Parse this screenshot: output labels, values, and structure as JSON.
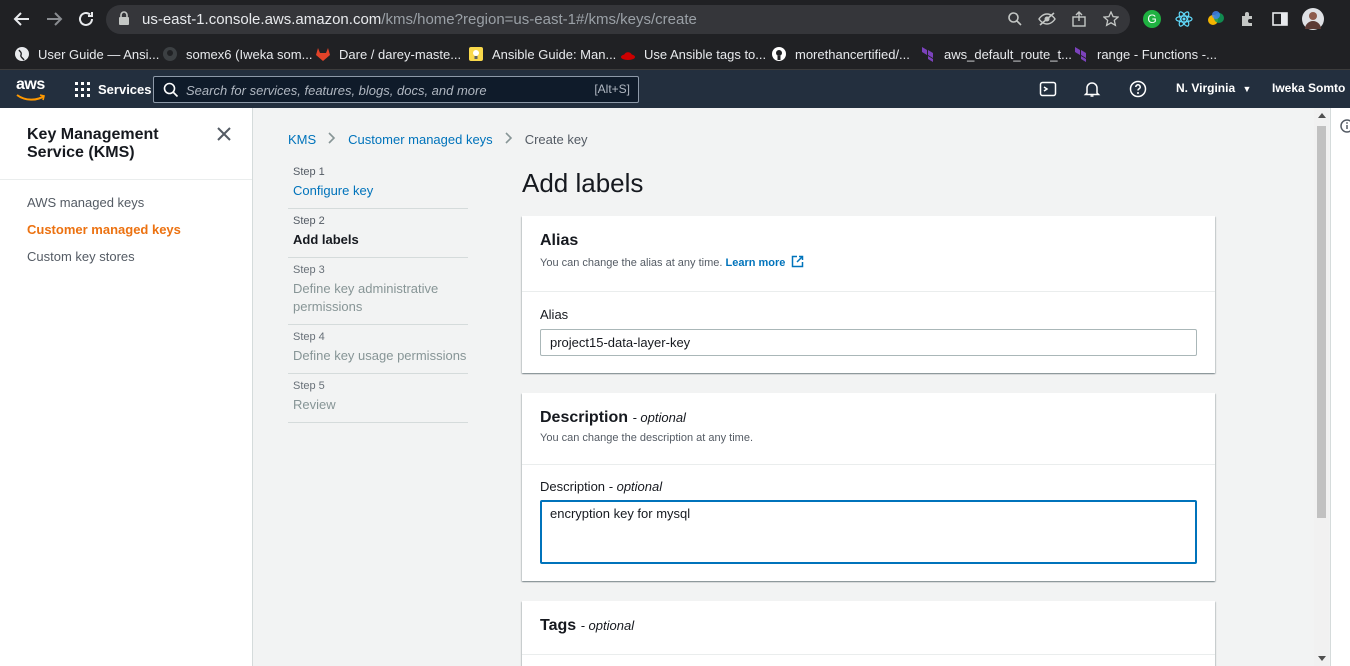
{
  "browser": {
    "url_host": "us-east-1.console.aws.amazon.com",
    "url_path": "/kms/home?region=us-east-1#/kms/keys/create",
    "bookmarks": [
      {
        "label": "User Guide — Ansi...",
        "icon": "globe-icon",
        "color": "#e8eaed"
      },
      {
        "label": "somex6 (Iweka som...",
        "icon": "github-icon",
        "color": "#5f6368"
      },
      {
        "label": "Dare / darey-maste...",
        "icon": "gitlab-icon",
        "color": "#e24329"
      },
      {
        "label": "Ansible Guide: Man...",
        "icon": "bulb-icon",
        "color": "#f9d94b"
      },
      {
        "label": "Use Ansible tags to...",
        "icon": "redhat-icon",
        "color": "#cc0000"
      },
      {
        "label": "morethancertified/...",
        "icon": "github-icon",
        "color": "#ffffff"
      },
      {
        "label": "aws_default_route_t...",
        "icon": "terraform-icon",
        "color": "#7b42bc"
      },
      {
        "label": "range - Functions -...",
        "icon": "terraform-icon",
        "color": "#7b42bc"
      }
    ]
  },
  "aws_header": {
    "logo": "aws",
    "services_label": "Services",
    "search_placeholder": "Search for services, features, blogs, docs, and more",
    "search_shortcut": "[Alt+S]",
    "region": "N. Virginia",
    "user": "Iweka Somto",
    "accent_color": "#ff9900"
  },
  "sidenav": {
    "title": "Key Management Service (KMS)",
    "items": [
      {
        "label": "AWS managed keys",
        "active": false
      },
      {
        "label": "Customer managed keys",
        "active": true
      },
      {
        "label": "Custom key stores",
        "active": false
      }
    ]
  },
  "breadcrumb": {
    "items": [
      {
        "label": "KMS",
        "link": true
      },
      {
        "label": "Customer managed keys",
        "link": true
      },
      {
        "label": "Create key",
        "link": false
      }
    ]
  },
  "steps": [
    {
      "num": "Step 1",
      "title": "Configure key",
      "state": "link"
    },
    {
      "num": "Step 2",
      "title": "Add labels",
      "state": "current"
    },
    {
      "num": "Step 3",
      "title": "Define key administrative permissions",
      "state": "disabled"
    },
    {
      "num": "Step 4",
      "title": "Define key usage permissions",
      "state": "disabled"
    },
    {
      "num": "Step 5",
      "title": "Review",
      "state": "disabled"
    }
  ],
  "main": {
    "heading": "Add labels",
    "alias_panel": {
      "title": "Alias",
      "desc": "You can change the alias at any time.",
      "learn_more": "Learn more",
      "field_label": "Alias",
      "value": "project15-data-layer-key"
    },
    "description_panel": {
      "title": "Description",
      "optional": "- optional",
      "desc": "You can change the description at any time.",
      "field_label": "Description",
      "field_optional": "- optional",
      "value": "encryption key for mysql"
    },
    "tags_panel": {
      "title": "Tags",
      "optional": "- optional"
    }
  }
}
